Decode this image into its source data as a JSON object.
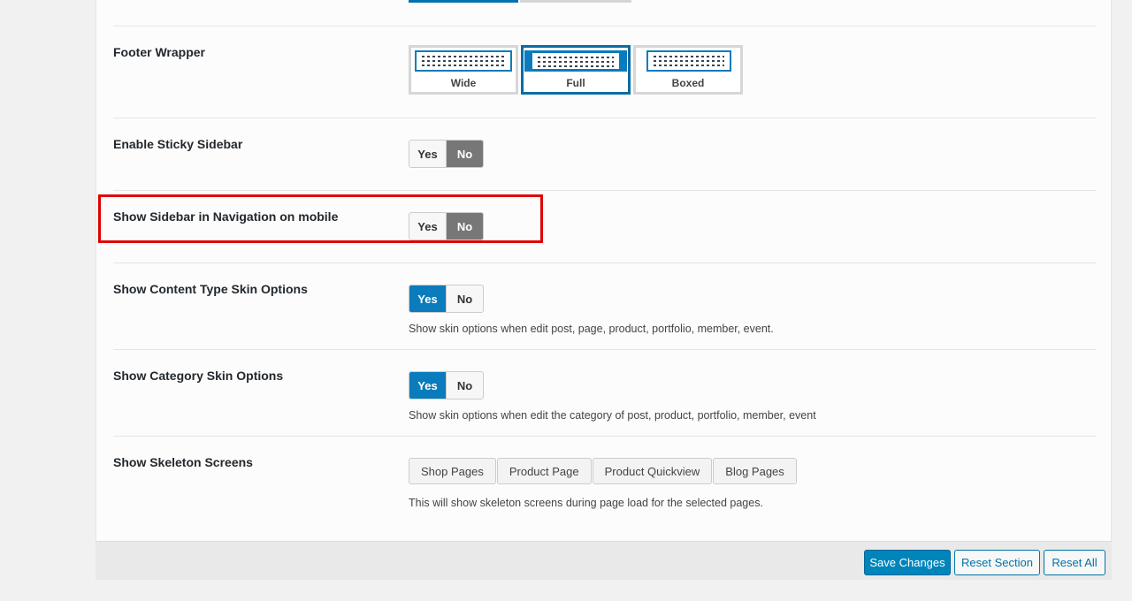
{
  "settings": {
    "footer_wrapper": {
      "label": "Footer Wrapper",
      "options": [
        "Wide",
        "Full",
        "Boxed"
      ],
      "selected": "Full"
    },
    "sticky_sidebar": {
      "label": "Enable Sticky Sidebar",
      "yes": "Yes",
      "no": "No",
      "value": "No"
    },
    "sidebar_nav_mobile": {
      "label": "Show Sidebar in Navigation on mobile",
      "yes": "Yes",
      "no": "No",
      "value": "No"
    },
    "content_type_skin": {
      "label": "Show Content Type Skin Options",
      "yes": "Yes",
      "no": "No",
      "value": "Yes",
      "hint": "Show skin options when edit post, page, product, portfolio, member, event."
    },
    "category_skin": {
      "label": "Show Category Skin Options",
      "yes": "Yes",
      "no": "No",
      "value": "Yes",
      "hint": "Show skin options when edit the category of post, product, portfolio, member, event"
    },
    "skeleton_screens": {
      "label": "Show Skeleton Screens",
      "options": [
        "Shop Pages",
        "Product Page",
        "Product Quickview",
        "Blog Pages"
      ],
      "hint": "This will show skeleton screens during page load for the selected pages."
    }
  },
  "footer": {
    "save": "Save Changes",
    "reset_section": "Reset Section",
    "reset_all": "Reset All"
  },
  "colors": {
    "accent": "#0073aa",
    "highlight": "#e00000",
    "switch_off": "#777777"
  }
}
